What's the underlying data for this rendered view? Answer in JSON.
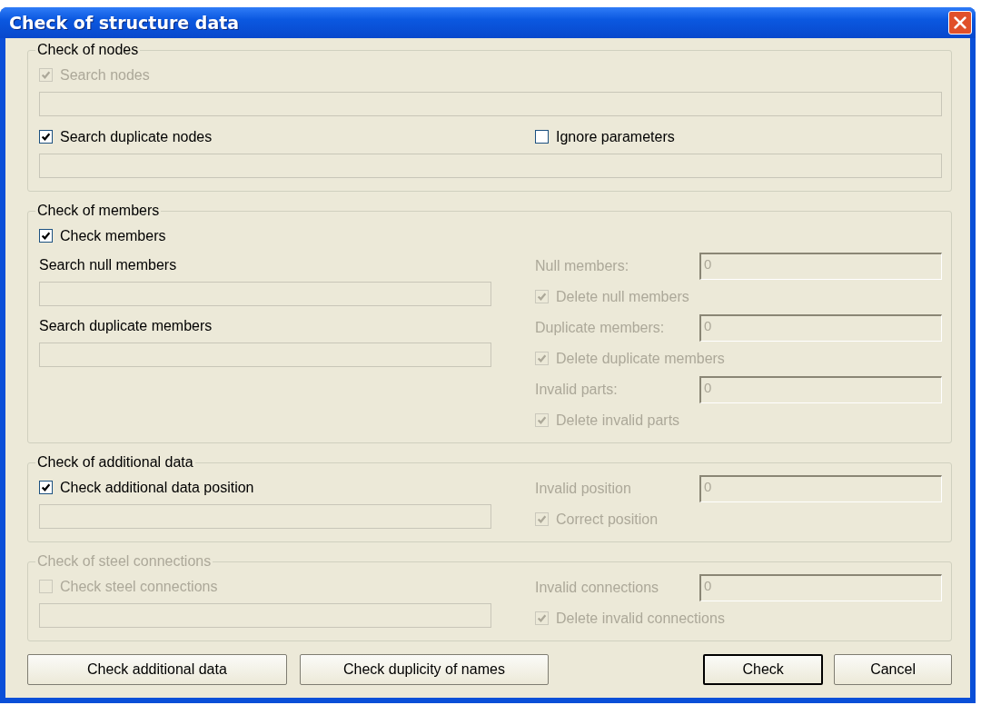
{
  "window": {
    "title": "Check of structure data"
  },
  "sections": [
    {
      "title": "Check of nodes",
      "disabled": false,
      "rows": [
        [
          {
            "kind": "checkbox",
            "label": "Search nodes",
            "checked": true,
            "disabled": true
          }
        ],
        [
          {
            "kind": "progress",
            "level": 0
          }
        ],
        [
          {
            "kind": "checkbox",
            "label": "Search duplicate nodes",
            "checked": true,
            "disabled": false
          },
          {
            "kind": "checkbox",
            "label": "Ignore parameters",
            "checked": false,
            "disabled": false
          }
        ],
        [
          {
            "kind": "progress",
            "level": 0
          }
        ]
      ]
    },
    {
      "title": "Check of members",
      "disabled": false,
      "left": [
        {
          "kind": "checkbox",
          "label": "Check members",
          "checked": true,
          "disabled": false
        },
        {
          "kind": "label",
          "label": "Search null members",
          "disabled": false
        },
        {
          "kind": "progress",
          "level": 0
        },
        {
          "kind": "label",
          "label": "Search duplicate members",
          "disabled": false
        },
        {
          "kind": "progress",
          "level": 0
        }
      ],
      "right": [
        {
          "kind": "spacer"
        },
        {
          "kind": "reading",
          "label": "Null members:",
          "value": "0",
          "disabled": true
        },
        {
          "kind": "checkbox",
          "label": "Delete null members",
          "checked": true,
          "disabled": true
        },
        {
          "kind": "reading",
          "label": "Duplicate members:",
          "value": "0",
          "disabled": true
        },
        {
          "kind": "checkbox",
          "label": "Delete duplicate members",
          "checked": true,
          "disabled": true
        },
        {
          "kind": "reading",
          "label": "Invalid parts:",
          "value": "0",
          "disabled": true
        },
        {
          "kind": "checkbox",
          "label": "Delete invalid parts",
          "checked": true,
          "disabled": true
        }
      ]
    },
    {
      "title": "Check of additional data",
      "disabled": false,
      "left": [
        {
          "kind": "checkbox",
          "label": "Check additional data position",
          "checked": true,
          "disabled": false
        },
        {
          "kind": "progress",
          "level": 0
        }
      ],
      "right": [
        {
          "kind": "reading",
          "label": "Invalid position",
          "value": "0",
          "disabled": true
        },
        {
          "kind": "checkbox",
          "label": "Correct position",
          "checked": true,
          "disabled": true
        }
      ]
    },
    {
      "title": "Check of steel connections",
      "disabled": true,
      "left": [
        {
          "kind": "checkbox",
          "label": "Check steel connections",
          "checked": false,
          "disabled": true
        },
        {
          "kind": "progress",
          "level": 0
        }
      ],
      "right": [
        {
          "kind": "reading",
          "label": "Invalid connections",
          "value": "0",
          "disabled": true
        },
        {
          "kind": "checkbox",
          "label": "Delete invalid connections",
          "checked": true,
          "disabled": true
        }
      ]
    }
  ],
  "buttons": [
    {
      "label": "Check additional data",
      "default": false
    },
    {
      "label": "Check duplicity of names",
      "default": false
    },
    {
      "label": "Check",
      "default": true
    },
    {
      "label": "Cancel",
      "default": false
    }
  ]
}
